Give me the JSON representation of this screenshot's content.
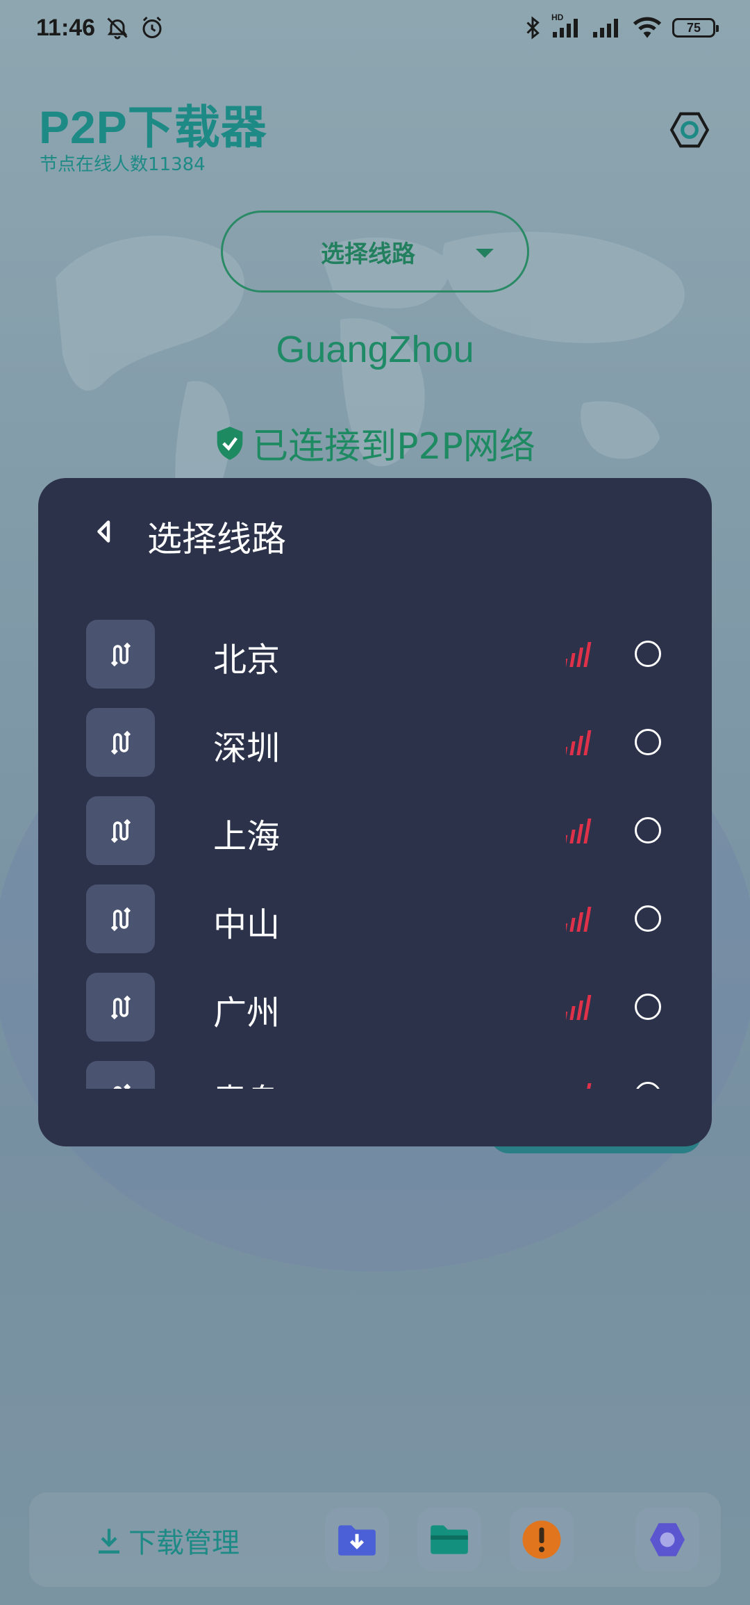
{
  "status_bar": {
    "time": "11:46",
    "network_label": "HD",
    "battery": "75"
  },
  "header": {
    "title": "P2P下载器",
    "subtitle": "节点在线人数11384"
  },
  "main": {
    "route_select_label": "选择线路",
    "city": "GuangZhou",
    "connection_status": "已连接到P2P网络"
  },
  "dialog": {
    "title": "选择线路",
    "routes": [
      {
        "name": "北京",
        "signal_color": "#e0314a",
        "selected": false
      },
      {
        "name": "深圳",
        "signal_color": "#e0314a",
        "selected": false
      },
      {
        "name": "上海",
        "signal_color": "#e0314a",
        "selected": false
      },
      {
        "name": "中山",
        "signal_color": "#e0314a",
        "selected": false
      },
      {
        "name": "广州",
        "signal_color": "#e0314a",
        "selected": false
      },
      {
        "name": "青岛",
        "signal_color": "#e0314a",
        "selected": false
      }
    ]
  },
  "bottom_bar": {
    "download_manager_label": "下载管理",
    "nav_colors": {
      "download_folder": "#4b5fd6",
      "folder": "#14917e",
      "alert": "#e0751e",
      "settings": "#5b55d0"
    }
  },
  "colors": {
    "accent": "#1d8a86",
    "dialog_bg": "#2c3249",
    "route_icon_bg": "#4a5370"
  }
}
